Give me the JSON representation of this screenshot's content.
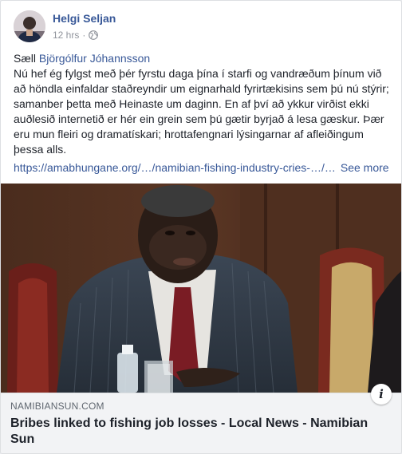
{
  "post": {
    "author": "Helgi Seljan",
    "time": "12 hrs",
    "separator": "·",
    "privacy_icon": "globe-icon",
    "greeting": "Sæll",
    "mention": "Björgólfur Jóhannsson",
    "body": "Nú hef ég fylgst með þér fyrstu daga þína í starfi og vandræðum þínum við að höndla einfaldar staðreyndir um eignarhald fyrirtækisins sem þú nú stýrir; samanber þetta með Heinaste um daginn. En af því að ykkur virðist ekki auðlesið internetið er hér ein grein sem þú gætir byrjað á lesa gæskur. Þær eru mun fleiri og dramatískari; hrottafengnari lýsingarnar af afleiðingum þessa alls.",
    "link_text": "https://amabhungane.org/…/namibian-fishing-industry-cries-…/…",
    "see_more": "See more"
  },
  "link_preview": {
    "domain": "NAMIBIANSUN.COM",
    "title": "Bribes linked to fishing job losses - Local News - Namibian Sun",
    "info_icon": "i"
  },
  "colors": {
    "link": "#385898",
    "text": "#1d2129",
    "meta": "#90949c",
    "preview_bg": "#f2f3f5"
  }
}
